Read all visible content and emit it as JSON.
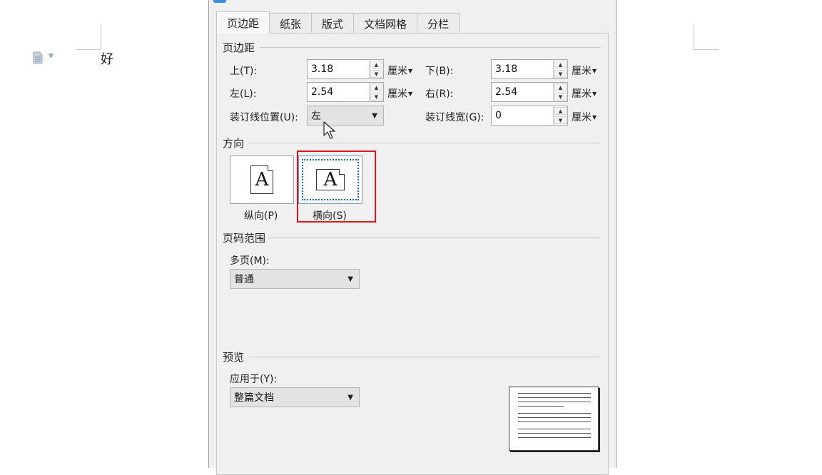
{
  "document": {
    "text": "好"
  },
  "dialog": {
    "tabs": [
      {
        "label": "页边距",
        "active": true
      },
      {
        "label": "纸张",
        "active": false
      },
      {
        "label": "版式",
        "active": false
      },
      {
        "label": "文档网格",
        "active": false
      },
      {
        "label": "分栏",
        "active": false
      }
    ],
    "margins": {
      "group_title": "页边距",
      "top": {
        "label": "上(T):",
        "value": "3.18",
        "unit": "厘米"
      },
      "bottom": {
        "label": "下(B):",
        "value": "3.18",
        "unit": "厘米"
      },
      "left": {
        "label": "左(L):",
        "value": "2.54",
        "unit": "厘米"
      },
      "right": {
        "label": "右(R):",
        "value": "2.54",
        "unit": "厘米"
      },
      "gutter_position": {
        "label": "装订线位置(U):",
        "value": "左"
      },
      "gutter_width": {
        "label": "装订线宽(G):",
        "value": "0",
        "unit": "厘米"
      }
    },
    "orientation": {
      "group_title": "方向",
      "portrait": {
        "label": "纵向(P)",
        "glyph": "A"
      },
      "landscape": {
        "label": "横向(S)",
        "glyph": "A",
        "selected": true
      }
    },
    "page_range": {
      "group_title": "页码范围",
      "multiple_pages": {
        "label": "多页(M):",
        "value": "普通"
      }
    },
    "preview": {
      "group_title": "预览",
      "apply_to": {
        "label": "应用于(Y):",
        "value": "整篇文档"
      }
    }
  },
  "colors": {
    "highlight": "#e0131b",
    "selection_dots": "#1e6fd0",
    "title_icon": "#3d8be2"
  }
}
